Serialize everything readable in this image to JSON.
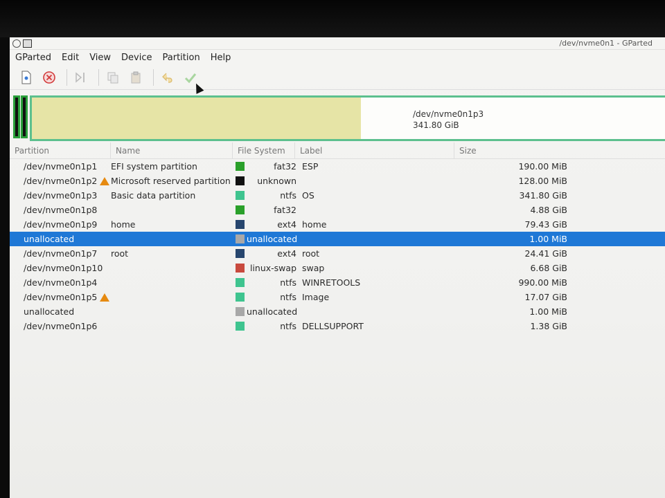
{
  "window": {
    "title": "/dev/nvme0n1 - GParted"
  },
  "menu": [
    "GParted",
    "Edit",
    "View",
    "Device",
    "Partition",
    "Help"
  ],
  "toolbar": {
    "new": "new-partition-icon",
    "delete": "delete-icon",
    "resize": "resize-move-icon",
    "copy": "copy-icon",
    "paste": "paste-icon",
    "undo": "undo-icon",
    "apply": "apply-icon"
  },
  "diskmap": {
    "label": "/dev/nvme0n1p3",
    "size": "341.80 GiB",
    "fill_fraction": 0.52
  },
  "columns": [
    "Partition",
    "Name",
    "File System",
    "Label",
    "Size"
  ],
  "rows": [
    {
      "partition": "/dev/nvme0n1p1",
      "warn": false,
      "name": "EFI system partition",
      "color": "#2aa02a",
      "fs": "fat32",
      "label": "ESP",
      "size": "190.00 MiB"
    },
    {
      "partition": "/dev/nvme0n1p2",
      "warn": true,
      "name": "Microsoft reserved partition",
      "color": "#111111",
      "fs": "unknown",
      "label": "",
      "size": "128.00 MiB"
    },
    {
      "partition": "/dev/nvme0n1p3",
      "warn": false,
      "name": "Basic data partition",
      "color": "#3fc48f",
      "fs": "ntfs",
      "label": "OS",
      "size": "341.80 GiB"
    },
    {
      "partition": "/dev/nvme0n1p8",
      "warn": false,
      "name": "",
      "color": "#2aa02a",
      "fs": "fat32",
      "label": "",
      "size": "4.88 GiB"
    },
    {
      "partition": "/dev/nvme0n1p9",
      "warn": false,
      "name": "home",
      "color": "#27466e",
      "fs": "ext4",
      "label": "home",
      "size": "79.43 GiB"
    },
    {
      "partition": "unallocated",
      "warn": false,
      "name": "",
      "color": "#a8a8a8",
      "fs": "unallocated",
      "label": "",
      "size": "1.00 MiB",
      "selected": true
    },
    {
      "partition": "/dev/nvme0n1p7",
      "warn": false,
      "name": "root",
      "color": "#27466e",
      "fs": "ext4",
      "label": "root",
      "size": "24.41 GiB"
    },
    {
      "partition": "/dev/nvme0n1p10",
      "warn": false,
      "name": "",
      "color": "#c84a3e",
      "fs": "linux-swap",
      "label": "swap",
      "size": "6.68 GiB"
    },
    {
      "partition": "/dev/nvme0n1p4",
      "warn": false,
      "name": "",
      "color": "#3fc48f",
      "fs": "ntfs",
      "label": "WINRETOOLS",
      "size": "990.00 MiB"
    },
    {
      "partition": "/dev/nvme0n1p5",
      "warn": true,
      "name": "",
      "color": "#3fc48f",
      "fs": "ntfs",
      "label": "Image",
      "size": "17.07 GiB"
    },
    {
      "partition": "unallocated",
      "warn": false,
      "name": "",
      "color": "#a8a8a8",
      "fs": "unallocated",
      "label": "",
      "size": "1.00 MiB"
    },
    {
      "partition": "/dev/nvme0n1p6",
      "warn": false,
      "name": "",
      "color": "#3fc48f",
      "fs": "ntfs",
      "label": "DELLSUPPORT",
      "size": "1.38 GiB"
    }
  ]
}
